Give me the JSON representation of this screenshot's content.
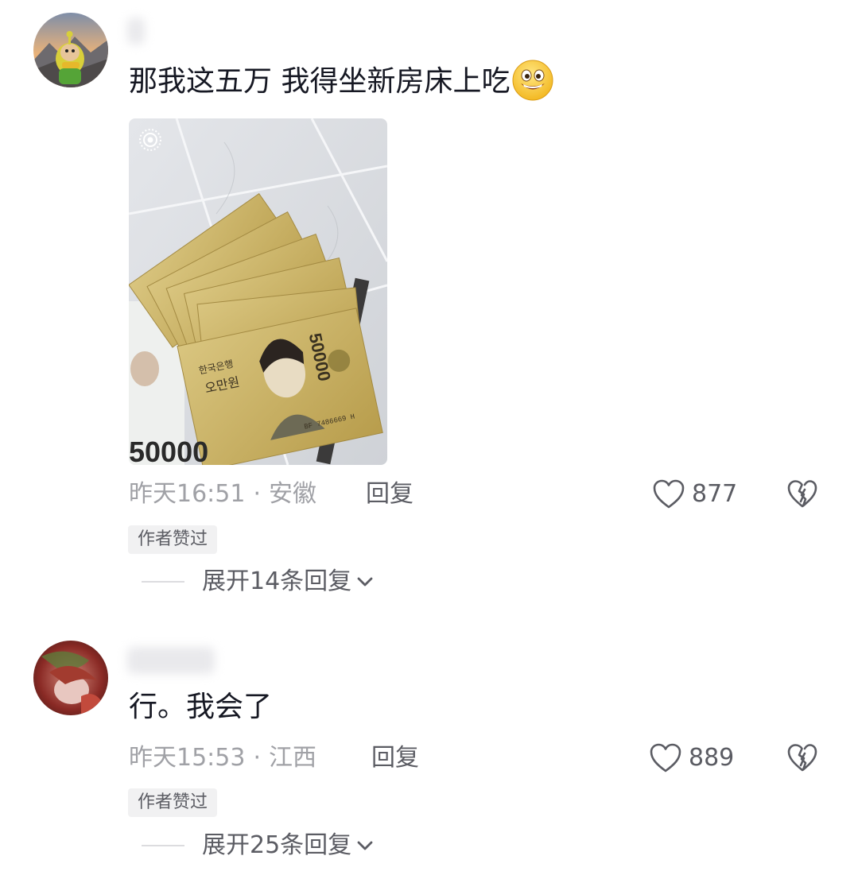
{
  "comments": [
    {
      "text": "那我这五万 我得坐新房床上吃",
      "emoji_icon": "grin-face-emoji",
      "attached_image": {
        "denomination_text": "50000",
        "bank_text": "한국은행",
        "value_text_korean": "오만원",
        "serial_text": "BF 7486669 H"
      },
      "time": "昨天16:51",
      "separator": "·",
      "location": "安徽",
      "reply_label": "回复",
      "like_count": "877",
      "author_badge": "作者赞过",
      "expand_label": "展开14条回复"
    },
    {
      "text": "行。我会了",
      "time": "昨天15:53",
      "separator": "·",
      "location": "江西",
      "reply_label": "回复",
      "like_count": "889",
      "author_badge": "作者赞过",
      "expand_label": "展开25条回复"
    }
  ],
  "colors": {
    "primary_text": "#161823",
    "secondary_text": "#5b5c63",
    "muted_text": "#a0a1a6",
    "badge_bg": "#f1f1f2",
    "banknote": "#c9b36a"
  },
  "icons": {
    "like": "heart-outline-icon",
    "dislike": "broken-heart-icon",
    "expand": "chevron-down-icon",
    "live_photo": "live-photo-icon"
  }
}
